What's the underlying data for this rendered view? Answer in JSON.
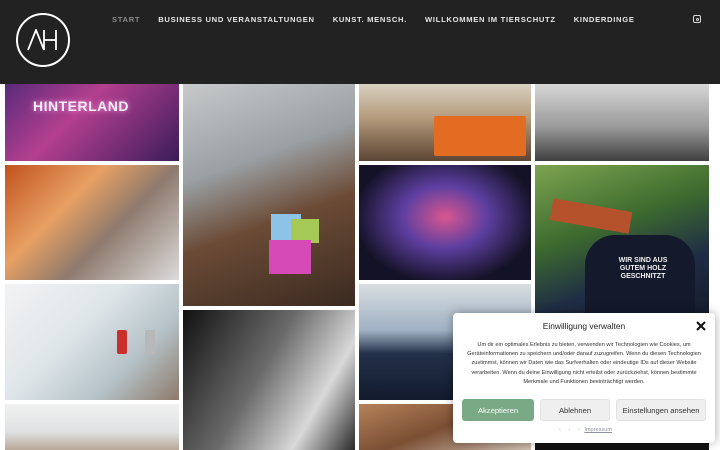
{
  "header": {
    "logo_alt": "AH",
    "nav": [
      {
        "label": "START",
        "active": true
      },
      {
        "label": "BUSINESS UND VERANSTALTUNGEN",
        "active": false
      },
      {
        "label": "KUNST. MENSCH.",
        "active": false
      },
      {
        "label": "WILLKOMMEN IM TIERSCHUTZ",
        "active": false
      },
      {
        "label": "KINDERDINGE",
        "active": false
      }
    ],
    "social_icon": "instagram-icon"
  },
  "gallery": {
    "sign_text": "HINTERLAND",
    "shirt_text": "WIR SIND AUS GUTEM HOLZ GESCHNITZT"
  },
  "consent": {
    "title": "Einwilligung verwalten",
    "text": "Um dir ein optimales Erlebnis zu bieten, verwenden wir Technologien wie Cookies, um Geräteinformationen zu speichern und/oder darauf zuzugreifen. Wenn du diesen Technologien zustimmst, können wir Daten wie das Surfverhalten oder eindeutige IDs auf dieser Website verarbeiten. Wenn du deine Einwilligung nicht erteilst oder zurückziehst, können bestimmte Merkmale und Funktionen beeinträchtigt werden.",
    "accept_label": "Akzeptieren",
    "deny_label": "Ablehnen",
    "prefs_label": "Einstellungen ansehen",
    "footer_link": "Impressum"
  },
  "colors": {
    "header_bg": "#222222",
    "accept_green": "#7aa985"
  }
}
